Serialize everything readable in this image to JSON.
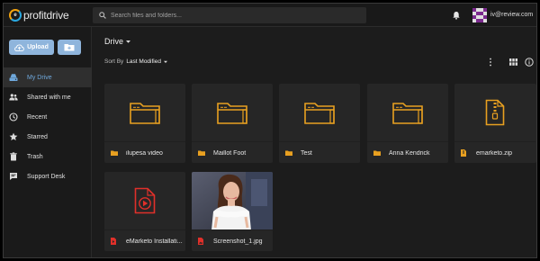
{
  "app": {
    "logo_mark": "e",
    "logo_text_a": "profit",
    "logo_text_b": "drive",
    "accent": "#f2a30f",
    "accent2": "#2aa8e0"
  },
  "search": {
    "placeholder": "Search files and folders..."
  },
  "header": {
    "user_email": "iv@review.com",
    "notification_icon": "bell-icon"
  },
  "sidebar": {
    "upload_label": "Upload",
    "items": [
      {
        "label": "My Drive",
        "icon": "drive-icon",
        "active": true
      },
      {
        "label": "Shared with me",
        "icon": "people-icon",
        "active": false
      },
      {
        "label": "Recent",
        "icon": "clock-icon",
        "active": false
      },
      {
        "label": "Starred",
        "icon": "star-icon",
        "active": false
      },
      {
        "label": "Trash",
        "icon": "trash-icon",
        "active": false
      },
      {
        "label": "Support Desk",
        "icon": "chat-icon",
        "active": false
      }
    ]
  },
  "main": {
    "title": "Drive",
    "sort_prefix": "Sort By",
    "sort_value": "Last Modified"
  },
  "files": [
    {
      "name": "ilupesa video",
      "kind": "folder"
    },
    {
      "name": "Maillot Foot",
      "kind": "folder"
    },
    {
      "name": "Test",
      "kind": "folder"
    },
    {
      "name": "Anna Kendrick",
      "kind": "folder"
    },
    {
      "name": "emarketo.zip",
      "kind": "zip"
    },
    {
      "name": "eMarketo Installati...",
      "kind": "video"
    },
    {
      "name": "Screenshot_1.jpg",
      "kind": "image"
    }
  ],
  "colors": {
    "folder": "#e8a020",
    "video": "#e0302a",
    "active_nav": "#6fa8dc",
    "upload_button": "#8fb5dc"
  }
}
